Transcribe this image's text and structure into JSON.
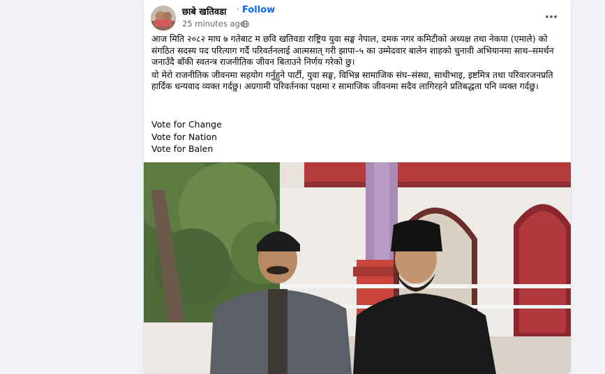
{
  "post": {
    "author": "छाबे खतिवडा",
    "separator": "·",
    "follow_label": "Follow",
    "timestamp": "25 minutes ago",
    "privacy_icon": "globe-icon",
    "more_icon": "more-options-icon",
    "paragraphs": [
      "आज मिति २०८२ माघ ७ गतेबाट म छवि खतिवडा राष्ट्रिय युवा सङ्घ नेपाल, दमक नगर कमिटीको अध्यक्ष तथा नेकपा (एमाले) को संगठित सदस्य पद परित्याग गर्दै परिवर्तनलाई आत्मसात् गरी झापा–५ का उम्मेदवार बालेन शाहको चुनावी अभियानमा साथ–समर्थन जनाउँदै बाँकी स्वतन्त्र राजनीतिक जीवन बिताउने निर्णय गरेको छु।",
      "यो मेरो राजनीतिक जीवनमा सहयोग गर्नुहुने पार्टी, युवा सङ्घ, विभिन्न सामाजिक संघ–संस्था, साथीभाइ, इष्टमित्र तथा परिवारजनप्रति हार्दिक धन्यवाद व्यक्त गर्दछु। अग्रगामी परिवर्तनका पक्षमा र सामाजिक जीवनमा सदैव लागिरहने प्रतिबद्धता पनि व्यक्त गर्दछु।"
    ],
    "votes": [
      "Vote for Change",
      "Vote for Nation",
      "Vote for Balen"
    ]
  },
  "colors": {
    "background": "#f0f2f5",
    "card": "#ffffff",
    "link_blue": "#0866ff",
    "secondary_text": "#65676b",
    "primary_text": "#050505"
  }
}
